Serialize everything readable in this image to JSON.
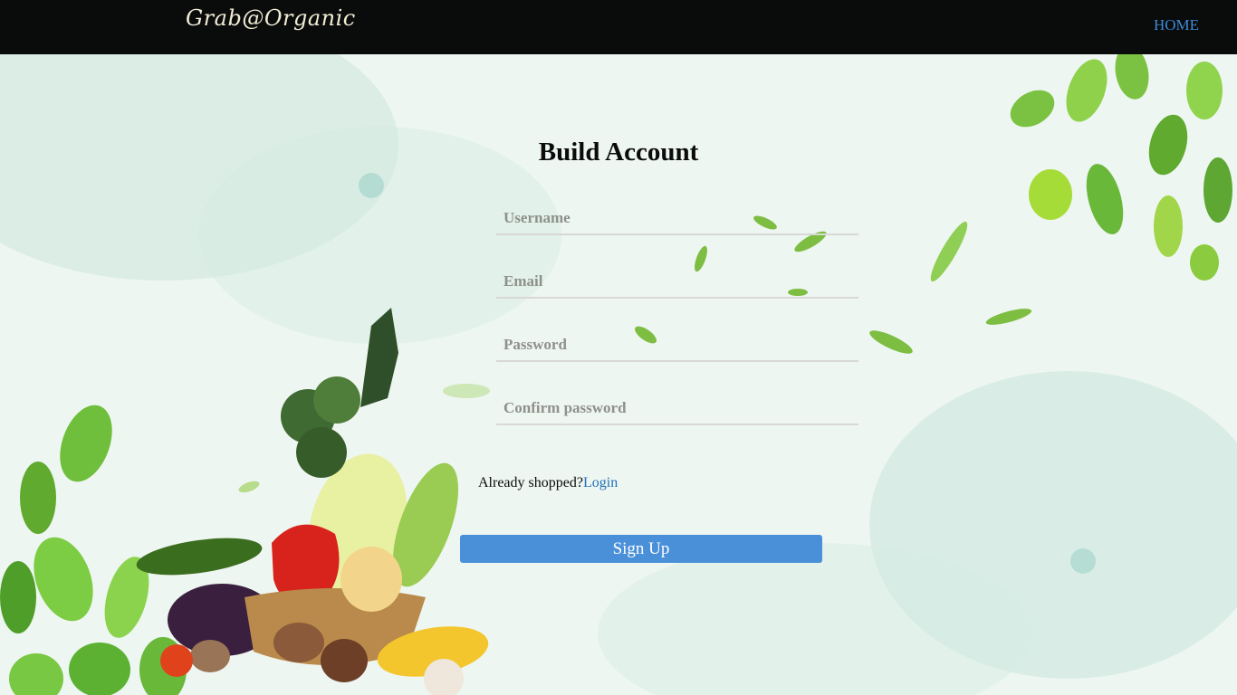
{
  "nav": {
    "logo": "Grab@Organic",
    "home": "HOME"
  },
  "form": {
    "title": "Build Account",
    "fields": [
      {
        "placeholder": "Username"
      },
      {
        "placeholder": "Email"
      },
      {
        "placeholder": "Password"
      },
      {
        "placeholder": "Confirm password"
      }
    ],
    "already_text": "Already shopped?",
    "login_link": "Login",
    "submit": "Sign Up"
  },
  "colors": {
    "navbar": "#0a0b0b",
    "link": "#3d8bd9",
    "button": "#4a90d9",
    "background": "#eef6f1"
  }
}
